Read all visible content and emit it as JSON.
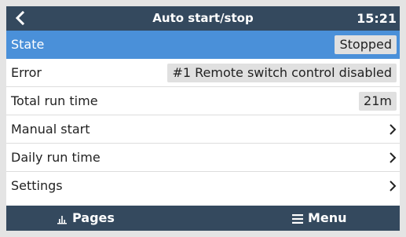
{
  "header": {
    "back_icon": "chevron-left-icon",
    "title": "Auto start/stop",
    "time": "15:21"
  },
  "rows": [
    {
      "label": "State",
      "value": "Stopped",
      "selected": true
    },
    {
      "label": "Error",
      "value": "#1 Remote switch control disabled"
    },
    {
      "label": "Total run time",
      "value": "21m"
    },
    {
      "label": "Manual start",
      "icon": "chevron-right-icon"
    },
    {
      "label": "Daily run time",
      "icon": "chevron-right-icon"
    },
    {
      "label": "Settings",
      "icon": "chevron-right-icon"
    }
  ],
  "footer": {
    "pages_label": "Pages",
    "pages_icon": "bar-chart-icon",
    "menu_label": "Menu",
    "menu_icon": "hamburger-icon"
  },
  "colors": {
    "header_bg": "#34495e",
    "selected_row_bg": "#4a90d9",
    "value_box_bg": "#e0e0e0"
  }
}
